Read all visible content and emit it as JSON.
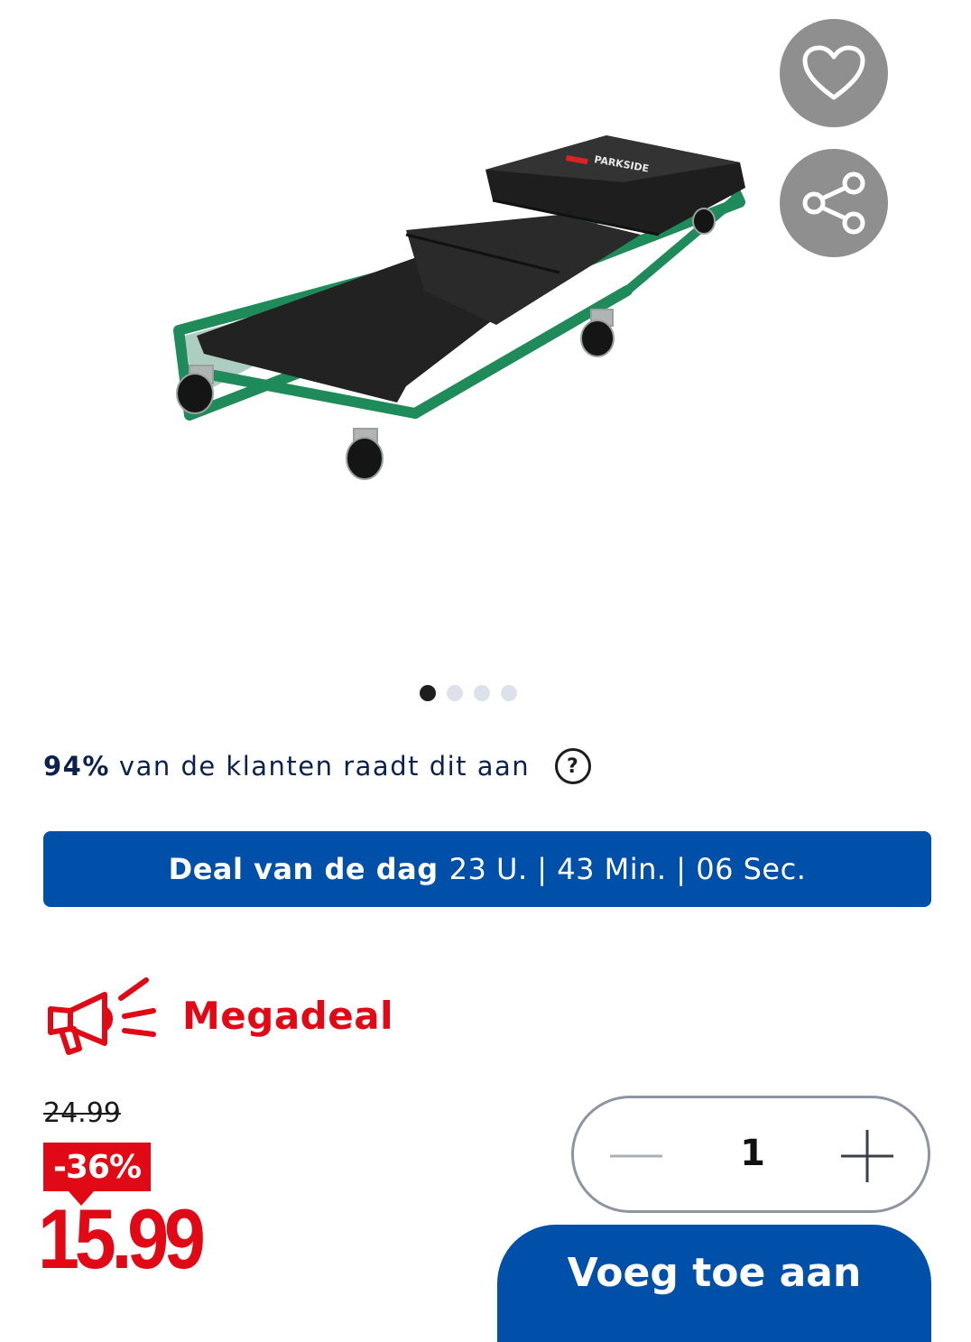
{
  "product": {
    "brand_logo_text": "PARKSIDE",
    "image_description_icon": "creeper-image"
  },
  "actions": {
    "favorite_icon": "heart-icon",
    "share_icon": "share-icon"
  },
  "gallery": {
    "total": 4,
    "active_index": 0
  },
  "recommendation": {
    "percent": "94%",
    "text": "van de klanten raadt dit aan",
    "help_symbol": "?"
  },
  "deal": {
    "label": "Deal van de dag",
    "countdown": "23 U. | 43 Min. | 06 Sec."
  },
  "megadeal": {
    "label": "Megadeal",
    "icon": "megaphone-icon"
  },
  "pricing": {
    "old_price": "24.99",
    "discount": "-36%",
    "price": "15.99"
  },
  "quantity": {
    "value": "1"
  },
  "cart": {
    "button_label": "Voeg toe aan"
  },
  "colors": {
    "primary_blue": "#0050aa",
    "brand_red": "#e10915",
    "frame_green": "#1f8a5a"
  }
}
